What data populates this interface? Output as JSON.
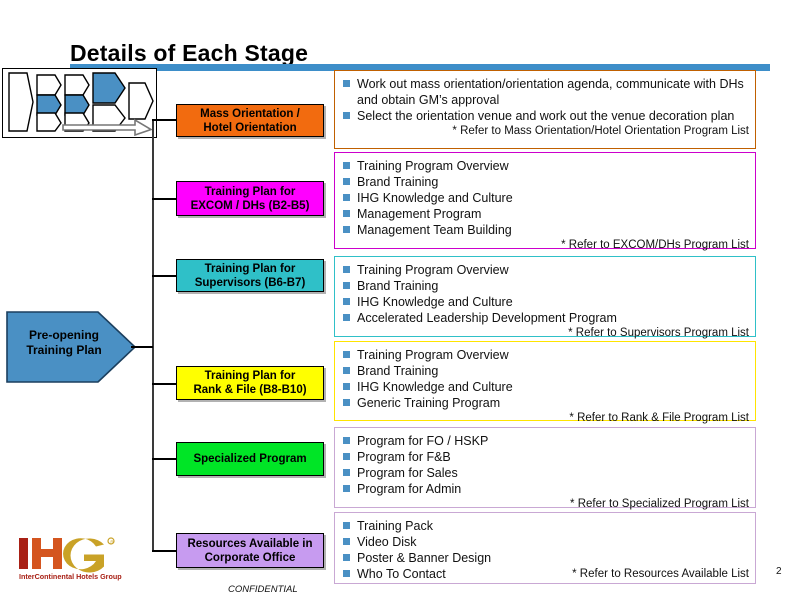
{
  "slide": {
    "title": "Details of Each Stage",
    "page_number": "2",
    "confidential": "CONFIDENTIAL",
    "accent_bar_color": "#3d8ec9"
  },
  "logo": {
    "name": "ihg-logo",
    "letters": [
      "I",
      "H",
      "G"
    ],
    "registered": "®",
    "tagline": "InterContinental Hotels Group",
    "colors": {
      "i": "#a82015",
      "h": "#d4551f",
      "g": "#c9a227",
      "tagline": "#a82015"
    }
  },
  "stage_arrow": {
    "label_line1": "Pre-opening",
    "label_line2": "Training  Plan",
    "fill": "#4a90c4",
    "stroke": "#1b3f5e"
  },
  "thumbnail": {
    "name": "process-overview-thumbnail",
    "highlight_color": "#4a90c4",
    "outline_color": "#000000"
  },
  "bullet_color": "#4a90c4",
  "rows": [
    {
      "key": "mass-orientation",
      "label_lines": [
        "Mass Orientation  /",
        "Hotel Orientation"
      ],
      "label_fill": "#f26b0f",
      "border": "#c06000",
      "bullets": [
        "Work out mass orientation/orientation  agenda,  communicate with DHs and  obtain  GM’s approval",
        "Select the orientation  venue  and  work  out the venue  decoration plan"
      ],
      "refer": "* Refer to Mass Orientation/Hotel Orientation Program List",
      "refer_inline": false
    },
    {
      "key": "excom-dhs",
      "label_lines": [
        "Training  Plan for",
        "EXCOM  / DHs (B2-B5)"
      ],
      "label_fill": "#ff00ff",
      "border": "#cc00cc",
      "bullets": [
        "Training Program Overview",
        "Brand Training",
        "IHG Knowledge  and Culture",
        "Management  Program",
        "Management  Team Building"
      ],
      "refer": "* Refer to EXCOM/DHs  Program List",
      "refer_inline": false
    },
    {
      "key": "supervisors",
      "label_lines": [
        "Training  Plan for",
        "Supervisors (B6-B7)"
      ],
      "label_fill": "#2fc0c8",
      "border": "#2fc0c8",
      "bullets": [
        "Training Program Overview",
        "Brand Training",
        "IHG Knowledge  and Culture",
        "Accelerated Leadership Development  Program"
      ],
      "refer": "* Refer to Supervisors Program List",
      "refer_inline": false
    },
    {
      "key": "rank-and-file",
      "label_lines": [
        "Training  Plan for",
        "Rank & File  (B8-B10)"
      ],
      "label_fill": "#ffff00",
      "border": "#ffe400",
      "bullets": [
        "Training Program Overview",
        "Brand Training",
        "IHG Knowledge  and Culture",
        "Generic Training Program"
      ],
      "refer": "* Refer to Rank & File Program List",
      "refer_inline": false
    },
    {
      "key": "specialized-program",
      "label_lines": [
        "Specialized  Program"
      ],
      "label_fill": "#00e526",
      "border": "#c9a8d4",
      "bullets": [
        "Program for  FO / HSKP",
        "Program for  F&B",
        "Program for  Sales",
        "Program for Admin"
      ],
      "refer": "* Refer to Specialized Program List",
      "refer_inline": false
    },
    {
      "key": "resources-available",
      "label_lines": [
        "Resources Available  in",
        "Corporate Office"
      ],
      "label_fill": "#c79bf0",
      "border": "#c9a8d4",
      "bullets": [
        "Training Pack",
        "Video Disk",
        "Poster & Banner Design",
        "Who To Contact"
      ],
      "refer": "* Refer to Resources Available List",
      "refer_inline": true
    }
  ]
}
